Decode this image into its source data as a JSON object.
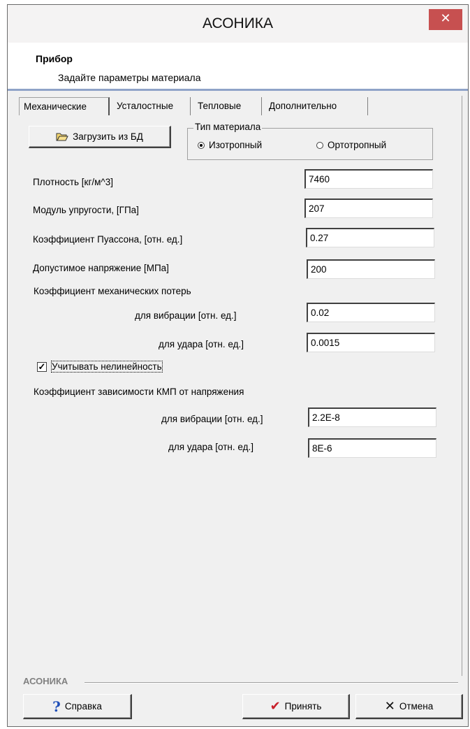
{
  "window": {
    "title": "АСОНИКА",
    "close_glyph": "✕"
  },
  "header": {
    "title": "Прибор",
    "subtitle": "Задайте параметры материала"
  },
  "tabs": [
    {
      "label": "Механические"
    },
    {
      "label": "Усталостные"
    },
    {
      "label": "Тепловые"
    },
    {
      "label": "Дополнительно"
    }
  ],
  "load_button": {
    "label": "Загрузить из БД",
    "icon": "folder-open-icon"
  },
  "material_type": {
    "label": "Тип материала",
    "options": [
      "Изотропный",
      "Ортотропный"
    ],
    "selected": "Изотропный"
  },
  "fields": {
    "density": {
      "label": "Плотность [кг/м^3]",
      "value": "7460"
    },
    "modulus": {
      "label": "Модуль упругости, [ГПа]",
      "value": "207"
    },
    "poisson": {
      "label": "Коэффициент Пуассона, [отн. ед.]",
      "value": "0.27"
    },
    "stress": {
      "label": "Допустимое напряжение [МПа]",
      "value": "200"
    },
    "loss_heading": "Коэффициент механических потерь",
    "loss_vibration": {
      "label": "для вибрации [отн. ед.]",
      "value": "0.02"
    },
    "loss_shock": {
      "label": "для удара [отн. ед.]",
      "value": "0.0015"
    },
    "nonlinear": {
      "label": "Учитывать нелинейность",
      "checked": true,
      "mark": "✓"
    },
    "kmp_heading": "Коэффициент зависимости КМП от напряжения",
    "kmp_vibration": {
      "label": "для вибрации [отн. ед.]",
      "value": "2.2E-8"
    },
    "kmp_shock": {
      "label": "для удара [отн. ед.]",
      "value": "8E-6"
    }
  },
  "footer": {
    "brand": "АСОНИКА",
    "help_label": "Справка",
    "accept_label": "Принять",
    "cancel_label": "Отмена",
    "help_glyph": "?",
    "accept_glyph": "✔",
    "cancel_glyph": "✕"
  },
  "colors": {
    "close_button": "#c75050",
    "accent_line": "#8fa3c8",
    "help_icon": "#1f4fb8",
    "accept_icon": "#c8202a"
  }
}
